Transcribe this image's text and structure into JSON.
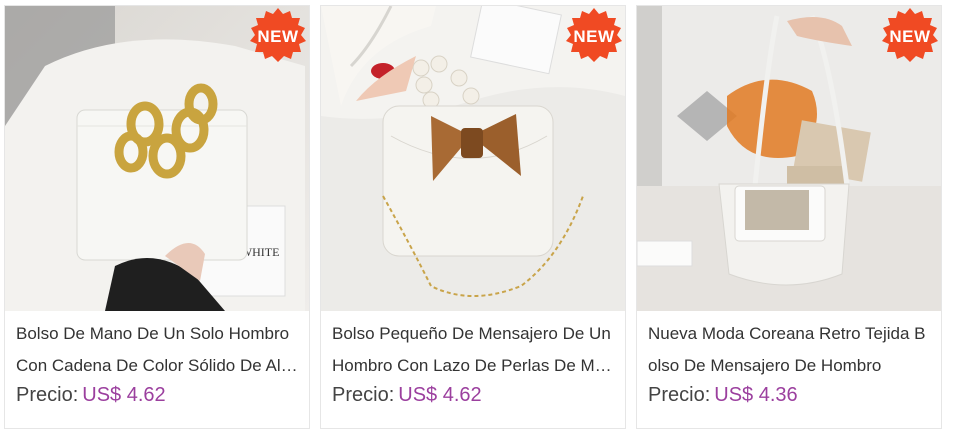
{
  "products": [
    {
      "badge": "NEW",
      "title": "Bolso De Mano De Un Solo Hombro Con Cadena De Color Sólido De Alta Calidad",
      "price_label": "Precio:",
      "price_value": "US$ 4.62"
    },
    {
      "badge": "NEW",
      "title": "Bolso Pequeño De Mensajero De Un Hombro Con Lazo De Perlas De Moda",
      "price_label": "Precio:",
      "price_value": "US$ 4.62"
    },
    {
      "badge": "NEW",
      "title": "Nueva Moda Coreana Retro Tejida Bolso De Mensajero De Hombro",
      "price_label": "Precio:",
      "price_value": "US$ 4.36"
    }
  ],
  "colors": {
    "badge": "#f04a23",
    "price": "#9b3f9e",
    "text": "#333333"
  },
  "icons": [
    "new-badge-icon"
  ]
}
